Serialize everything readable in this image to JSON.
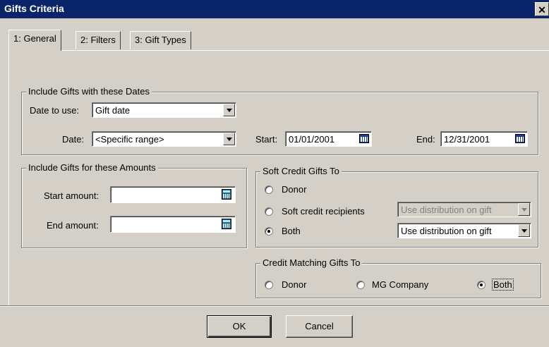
{
  "window": {
    "title": "Gifts Criteria",
    "close_glyph": "✕"
  },
  "tabs": [
    {
      "label": "1: General"
    },
    {
      "label": "2: Filters"
    },
    {
      "label": "3: Gift Types"
    }
  ],
  "dates_group": {
    "legend": "Include Gifts with these Dates",
    "date_to_use_label": "Date to use:",
    "date_to_use_value": "Gift date",
    "date_label": "Date:",
    "date_value": "<Specific range>",
    "start_label": "Start:",
    "start_value": "01/01/2001",
    "end_label": "End:",
    "end_value": "12/31/2001"
  },
  "amounts_group": {
    "legend": "Include Gifts for these Amounts",
    "start_label": "Start amount:",
    "start_value": "",
    "end_label": "End amount:",
    "end_value": ""
  },
  "soft_credit_group": {
    "legend": "Soft Credit Gifts To",
    "options": [
      {
        "label": "Donor",
        "checked": false
      },
      {
        "label": "Soft credit recipients",
        "checked": false
      },
      {
        "label": "Both",
        "checked": true
      }
    ],
    "recipients_distribution": "Use distribution on gift",
    "both_distribution": "Use distribution on gift"
  },
  "matching_group": {
    "legend": "Credit Matching Gifts To",
    "options": [
      {
        "label": "Donor",
        "checked": false
      },
      {
        "label": "MG Company",
        "checked": false
      },
      {
        "label": "Both",
        "checked": true
      }
    ]
  },
  "buttons": {
    "ok": "OK",
    "cancel": "Cancel"
  }
}
